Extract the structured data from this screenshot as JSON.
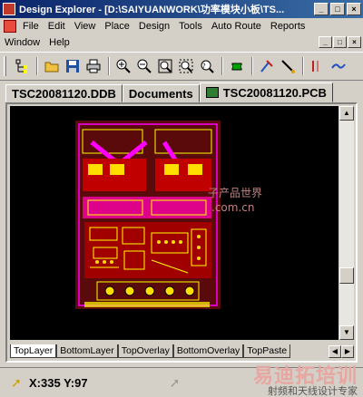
{
  "window": {
    "title": "Design Explorer - [D:\\SAIYUANWORK\\功率模块小板\\TS...",
    "min": "_",
    "max": "□",
    "close": "×"
  },
  "menu": {
    "row1": [
      "File",
      "Edit",
      "View",
      "Place",
      "Design",
      "Tools",
      "Auto Route",
      "Reports"
    ],
    "row2": [
      "Window",
      "Help"
    ]
  },
  "toolbar": {
    "icons": [
      "tree-icon",
      "open-folder-icon",
      "save-icon",
      "print-icon",
      "zoom-in-icon",
      "zoom-out-icon",
      "zoom-fit-icon",
      "zoom-area-icon",
      "zoom-last-icon",
      "component-icon",
      "route-tool-icon",
      "wire-icon",
      "line-icon",
      "ratsnest-icon"
    ]
  },
  "tabs": {
    "ddb": "TSC20081120.DDB",
    "documents": "Documents",
    "pcb": "TSC20081120.PCB"
  },
  "canvas": {
    "watermark_text": "子产品世界",
    "watermark_sub": ".com.cn"
  },
  "layer_tabs": [
    "TopLayer",
    "BottomLayer",
    "TopOverlay",
    "BottomOverlay",
    "TopPaste"
  ],
  "status": {
    "coords": "X:335 Y:97"
  },
  "watermark": {
    "main": "易迪拓培训",
    "sub": "射频和天线设计专家"
  }
}
